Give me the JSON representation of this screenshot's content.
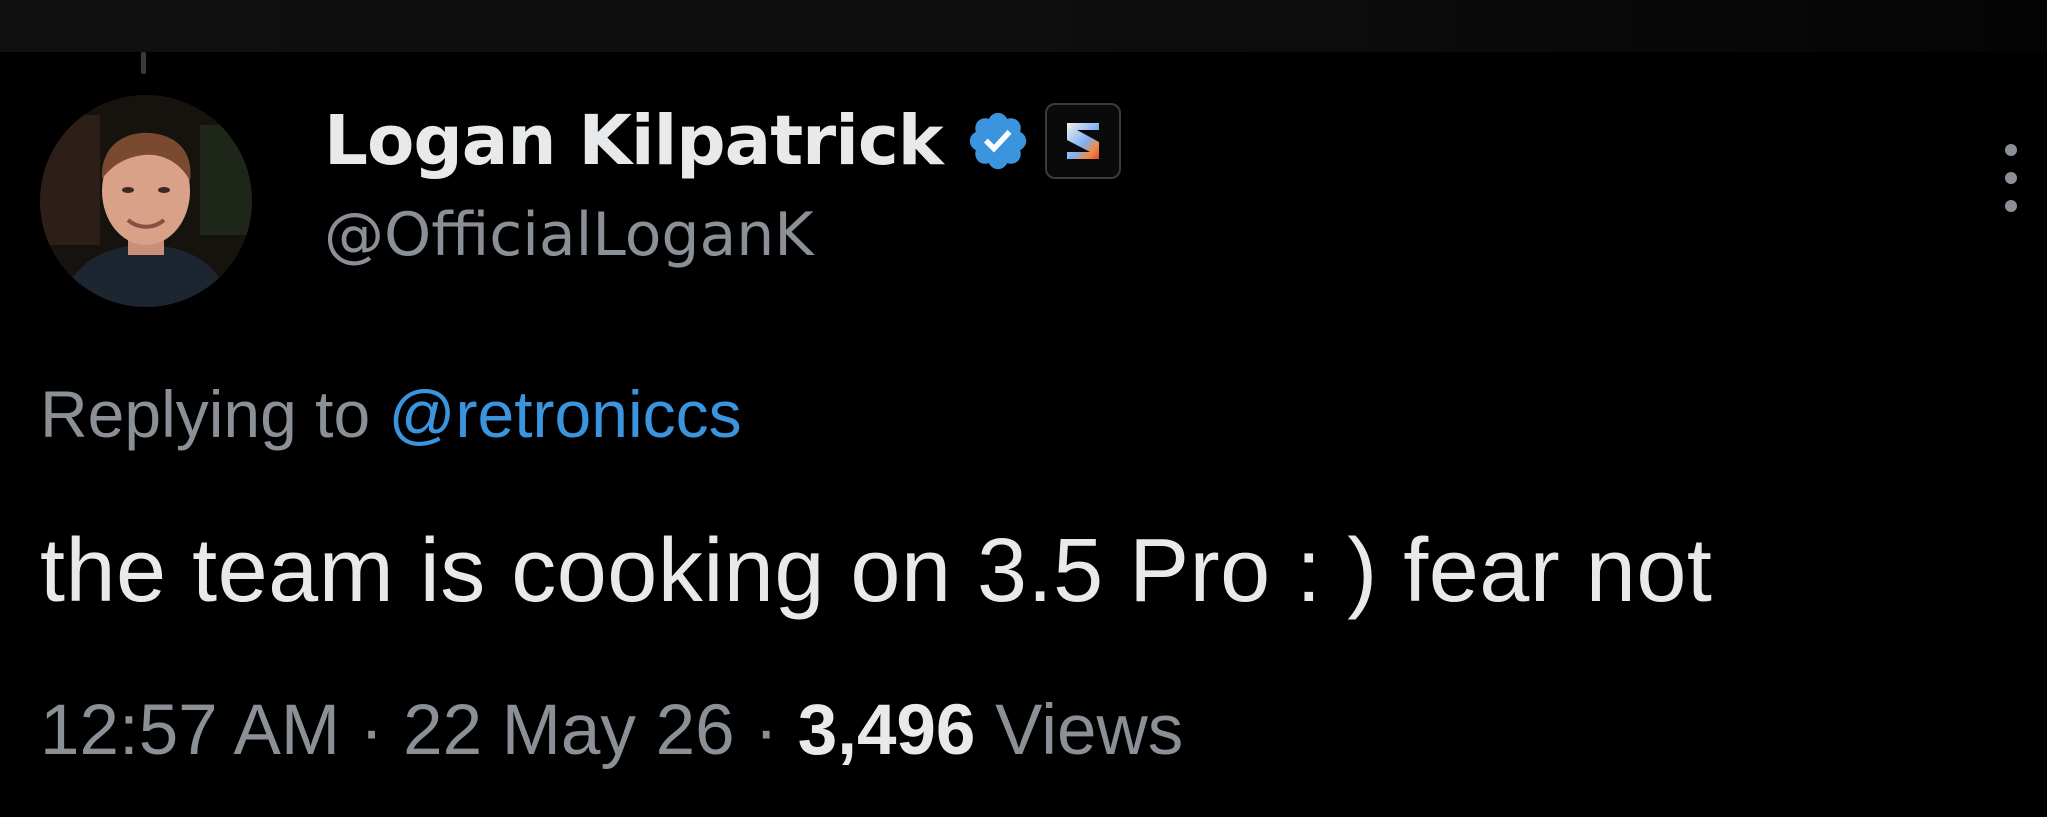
{
  "tweet": {
    "author": {
      "display_name": "Logan Kilpatrick",
      "handle": "@OfficialLoganK",
      "verified_icon": "verified-badge-icon",
      "affiliate_icon": "affiliate-logo-icon"
    },
    "reply_context": {
      "prefix": "Replying to ",
      "mention": "@retroniccs"
    },
    "text": "the team is cooking on 3.5 Pro : ) fear not",
    "meta": {
      "time": "12:57 AM",
      "separator": " · ",
      "date": "22 May 26",
      "views_count": "3,496",
      "views_label": " Views"
    },
    "more_icon": "more-options-icon"
  },
  "colors": {
    "background": "#000000",
    "primary_text": "#e7e9ea",
    "secondary_text": "#8b9096",
    "accent": "#3b95de"
  }
}
